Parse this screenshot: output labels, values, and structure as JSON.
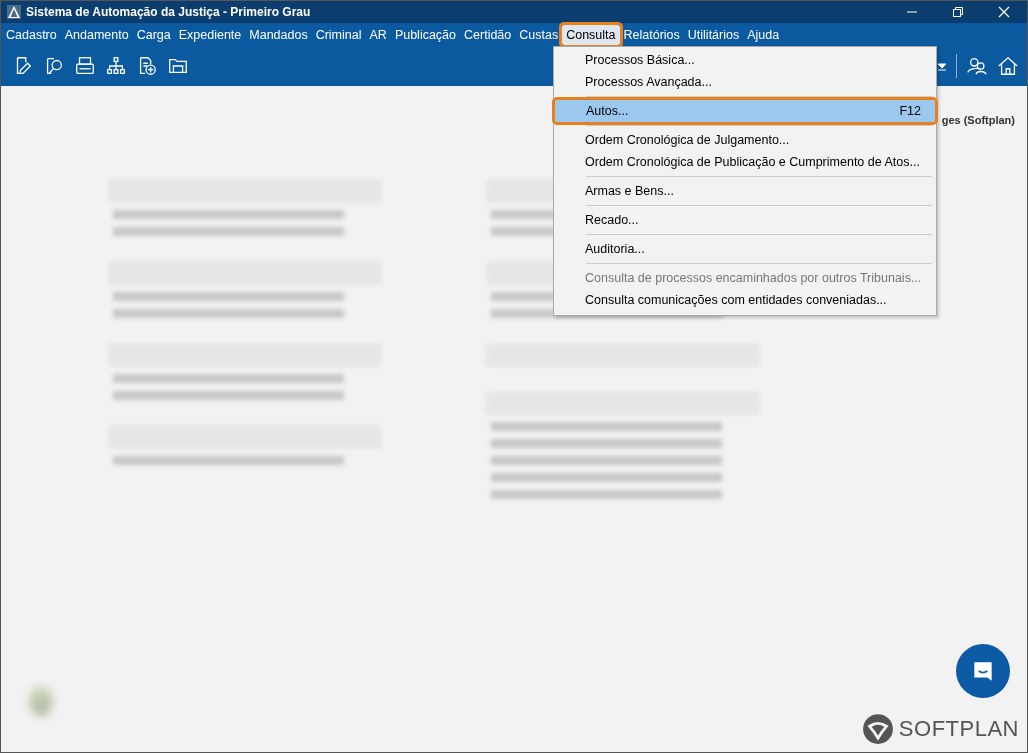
{
  "window": {
    "title": "Sistema de Automação da Justiça - Primeiro Grau"
  },
  "menubar": [
    {
      "label": "Cadastro",
      "selected": false
    },
    {
      "label": "Andamento",
      "selected": false
    },
    {
      "label": "Carga",
      "selected": false
    },
    {
      "label": "Expediente",
      "selected": false
    },
    {
      "label": "Mandados",
      "selected": false
    },
    {
      "label": "Criminal",
      "selected": false
    },
    {
      "label": "AR",
      "selected": false
    },
    {
      "label": "Publicação",
      "selected": false
    },
    {
      "label": "Certidão",
      "selected": false
    },
    {
      "label": "Custas",
      "selected": false
    },
    {
      "label": "Consulta",
      "selected": true
    },
    {
      "label": "Relatórios",
      "selected": false
    },
    {
      "label": "Utilitários",
      "selected": false
    },
    {
      "label": "Ajuda",
      "selected": false
    }
  ],
  "dropdown": [
    {
      "kind": "item",
      "label": "Processos Básica...",
      "selected": false,
      "disabled": false
    },
    {
      "kind": "item",
      "label": "Processos Avançada...",
      "selected": false,
      "disabled": false
    },
    {
      "kind": "separator"
    },
    {
      "kind": "item",
      "label": "Autos...",
      "shortcut": "F12",
      "selected": true,
      "disabled": false
    },
    {
      "kind": "separator"
    },
    {
      "kind": "item",
      "label": "Ordem Cronológica de Julgamento...",
      "selected": false,
      "disabled": false
    },
    {
      "kind": "item",
      "label": "Ordem Cronológica de Publicação e Cumprimento de Atos...",
      "selected": false,
      "disabled": false
    },
    {
      "kind": "separator"
    },
    {
      "kind": "item",
      "label": "Armas e Bens...",
      "selected": false,
      "disabled": false
    },
    {
      "kind": "separator"
    },
    {
      "kind": "item",
      "label": "Recado...",
      "selected": false,
      "disabled": false
    },
    {
      "kind": "separator"
    },
    {
      "kind": "item",
      "label": "Auditoria...",
      "selected": false,
      "disabled": false
    },
    {
      "kind": "separator"
    },
    {
      "kind": "item",
      "label": "Consulta de processos encaminhados por outros Tribunais...",
      "selected": false,
      "disabled": true
    },
    {
      "kind": "item",
      "label": "Consulta comunicações com entidades conveniadas...",
      "selected": false,
      "disabled": false
    }
  ],
  "user_label": "ges (Softplan)",
  "logo_text": "SOFTPLAN"
}
